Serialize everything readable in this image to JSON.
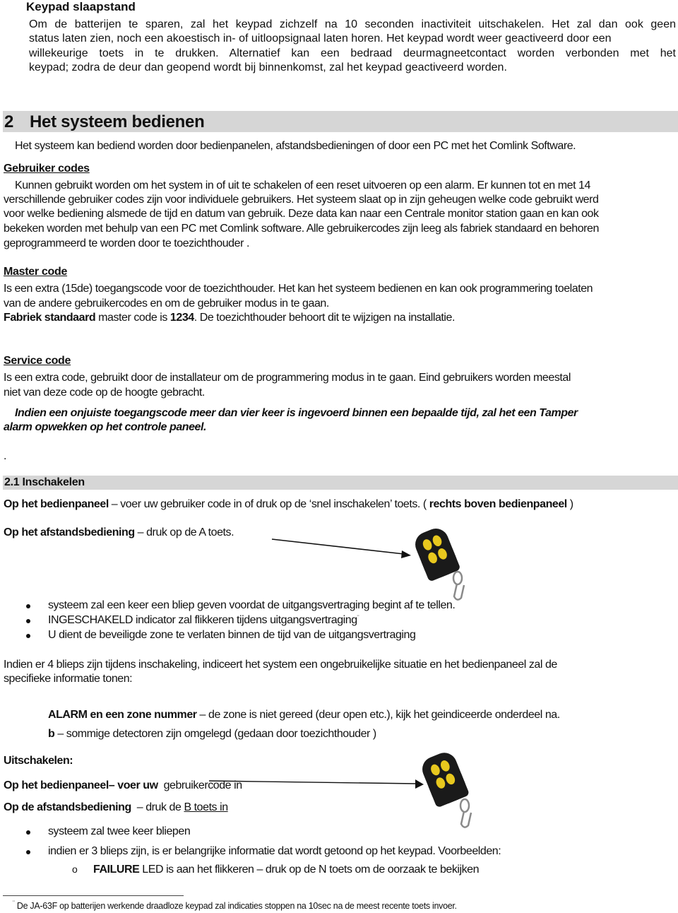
{
  "keypad_sleep": {
    "title": "Keypad slaapstand",
    "lines": [
      "Om de batterijen te sparen, zal het keypad zichzelf na 10 seconden inactiviteit uitschakelen. Het zal dan ook geen",
      "status laten zien, noch een akoestisch in- of uitloopsignaal laten horen. Het keypad wordt weer geactiveerd door een",
      "willekeurige toets in te drukken. Alternatief kan een bedraad deurmagneetcontact worden verbonden met het",
      "keypad; zodra de deur dan geopend wordt bij binnenkomst, zal het keypad geactiveerd worden."
    ]
  },
  "section2": {
    "number": "2",
    "title": "Het systeem bedienen",
    "intro": "Het systeem kan bediend worden door bedienpanelen, afstandsbedieningen of door een PC met het Comlink Software."
  },
  "user_codes": {
    "heading": "Gebruiker codes",
    "lines": [
      "Kunnen gebruikt worden om het system in of uit te schakelen of een reset uitvoeren op een alarm. Er kunnen tot en met 14",
      "verschillende gebruiker codes zijn voor individuele gebruikers. Het systeem slaat op in zijn geheugen welke code gebruikt werd",
      "voor welke bediening alsmede de tijd en datum van gebruik. Deze data kan naar een Centrale monitor station gaan en kan ook",
      "bekeken worden met behulp van een PC met Comlink software. Alle gebruikercodes zijn leeg als fabriek standaard en behoren",
      "geprogrammeerd te worden door te toezichthouder ."
    ]
  },
  "master_code": {
    "heading": "Master code",
    "lines": [
      "Is een extra (15de) toegangscode voor de toezichthouder. Het kan het systeem bedienen en kan ook programmering toelaten",
      "van de andere gebruikercodes en om de gebruiker modus in te gaan."
    ],
    "factory_bold": "Fabriek standaard",
    "factory_mid": " master code is ",
    "factory_code": "1234",
    "factory_end": ". De toezichthouder behoort dit te wijzigen na installatie."
  },
  "service_code": {
    "heading": "Service code",
    "lines": [
      "Is een extra code, gebruikt door de installateur om de programmering modus in te gaan. Eind gebruikers worden meestal",
      "niet van deze code op de hoogte gebracht."
    ],
    "warning_lines": [
      "Indien een onjuiste toegangscode meer dan vier keer is ingevoerd binnen een bepaalde tijd, zal het een Tamper",
      "alarm opwekken op het controle paneel."
    ],
    "stray_dot": "."
  },
  "section21": {
    "number": "2.1",
    "title": "Inschakelen",
    "panel_bold": "Op het bedienpaneel",
    "panel_text": " – voer uw gebruiker code in of druk op de ‘snel inschakelen’ toets. ( ",
    "panel_bold2": "rechts boven bedienpaneel",
    "panel_end": " )",
    "remote_bold": "Op het afstandsbediening",
    "remote_text": " – druk op de A toets.",
    "bullets": [
      "systeem zal een keer een bliep geven voordat de uitgangsvertraging begint af te tellen.",
      "INGESCHAKELD indicator zal flikkeren tijdens uitgangsvertraging",
      "U dient de beveiligde zone te verlaten binnen de tijd van de uitgangsvertraging"
    ],
    "footnote_mark": "¨",
    "four_beeps_lines": [
      "Indien er 4 blieps zijn tijdens inschakeling, indiceert het system een ongebruikelijke situatie en het bedienpaneel zal de",
      "specifieke informatie tonen:"
    ],
    "alarm_bold": "ALARM en een zone nummer",
    "alarm_text": " – de zone is niet gereed (deur open etc.), kijk het geindiceerde onderdeel na.",
    "b_bold": "b",
    "b_text": " – sommige detectoren zijn omgelegd (gedaan door toezichthouder )"
  },
  "disarm": {
    "heading": "Uitschakelen:",
    "panel_bold": "Op het bedienpaneel– voer uw",
    "panel_text": "  gebruikercode in",
    "remote_bold": "Op de afstandsbediening",
    "remote_text": "  – druk de ",
    "remote_link": "B toets in",
    "bullets": [
      "systeem zal twee keer bliepen",
      "indien er 3 blieps zijn, is er belangrijke informatie dat wordt getoond op het keypad. Voorbeelden:"
    ],
    "sub_bullet_marker": "o",
    "sub_bullet_bold": "FAILURE",
    "sub_bullet_text": " LED is aan het flikkeren – druk op de N toets om de oorzaak te bekijken"
  },
  "footnote": {
    "mark": "¨",
    "text": " De JA-63F op batterijen werkende draadloze keypad zal indicaties stoppen na 10sec na de meest recente toets invoer."
  },
  "colors": {
    "heading_bar": "#d6d6d6",
    "remote_body": "#1a1a1a",
    "remote_buttons": "#e8c81e"
  }
}
